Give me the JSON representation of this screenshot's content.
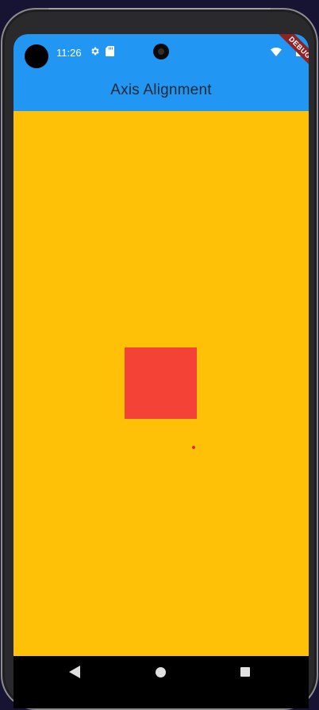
{
  "status_bar": {
    "time": "11:26",
    "icons": [
      "gear-icon",
      "sd-card-icon",
      "wifi-icon",
      "battery-icon"
    ],
    "debug_banner": "DEBUG"
  },
  "app_bar": {
    "title": "Axis Alignment",
    "background": "#2196f3"
  },
  "body": {
    "background": "#ffc107",
    "box_color": "#f44336"
  },
  "nav_bar": {
    "buttons": [
      "back-icon",
      "home-icon",
      "recents-icon"
    ]
  }
}
